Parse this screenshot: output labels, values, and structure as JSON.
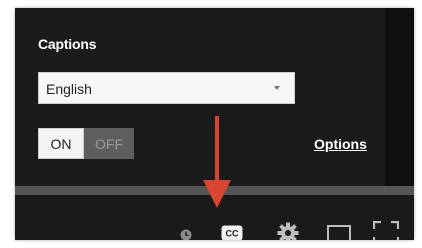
{
  "captions_panel": {
    "title": "Captions",
    "language_select": {
      "value": "English"
    },
    "toggle": {
      "on_label": "ON",
      "off_label": "OFF",
      "state": "on"
    },
    "options_link": "Options"
  },
  "controls": {
    "icons": [
      "clock-icon",
      "closed-captions-icon",
      "gear-icon",
      "miniplayer-icon",
      "fullscreen-icon"
    ],
    "cc_label": "CC"
  },
  "annotation": {
    "color": "#d9462f"
  },
  "colors": {
    "panel_bg": "#1b1b1b",
    "control_bar_bg": "#1a1a1a",
    "progress_bg": "#555555",
    "on_bg": "#f4f4f4",
    "off_bg": "#5e5e5e"
  }
}
